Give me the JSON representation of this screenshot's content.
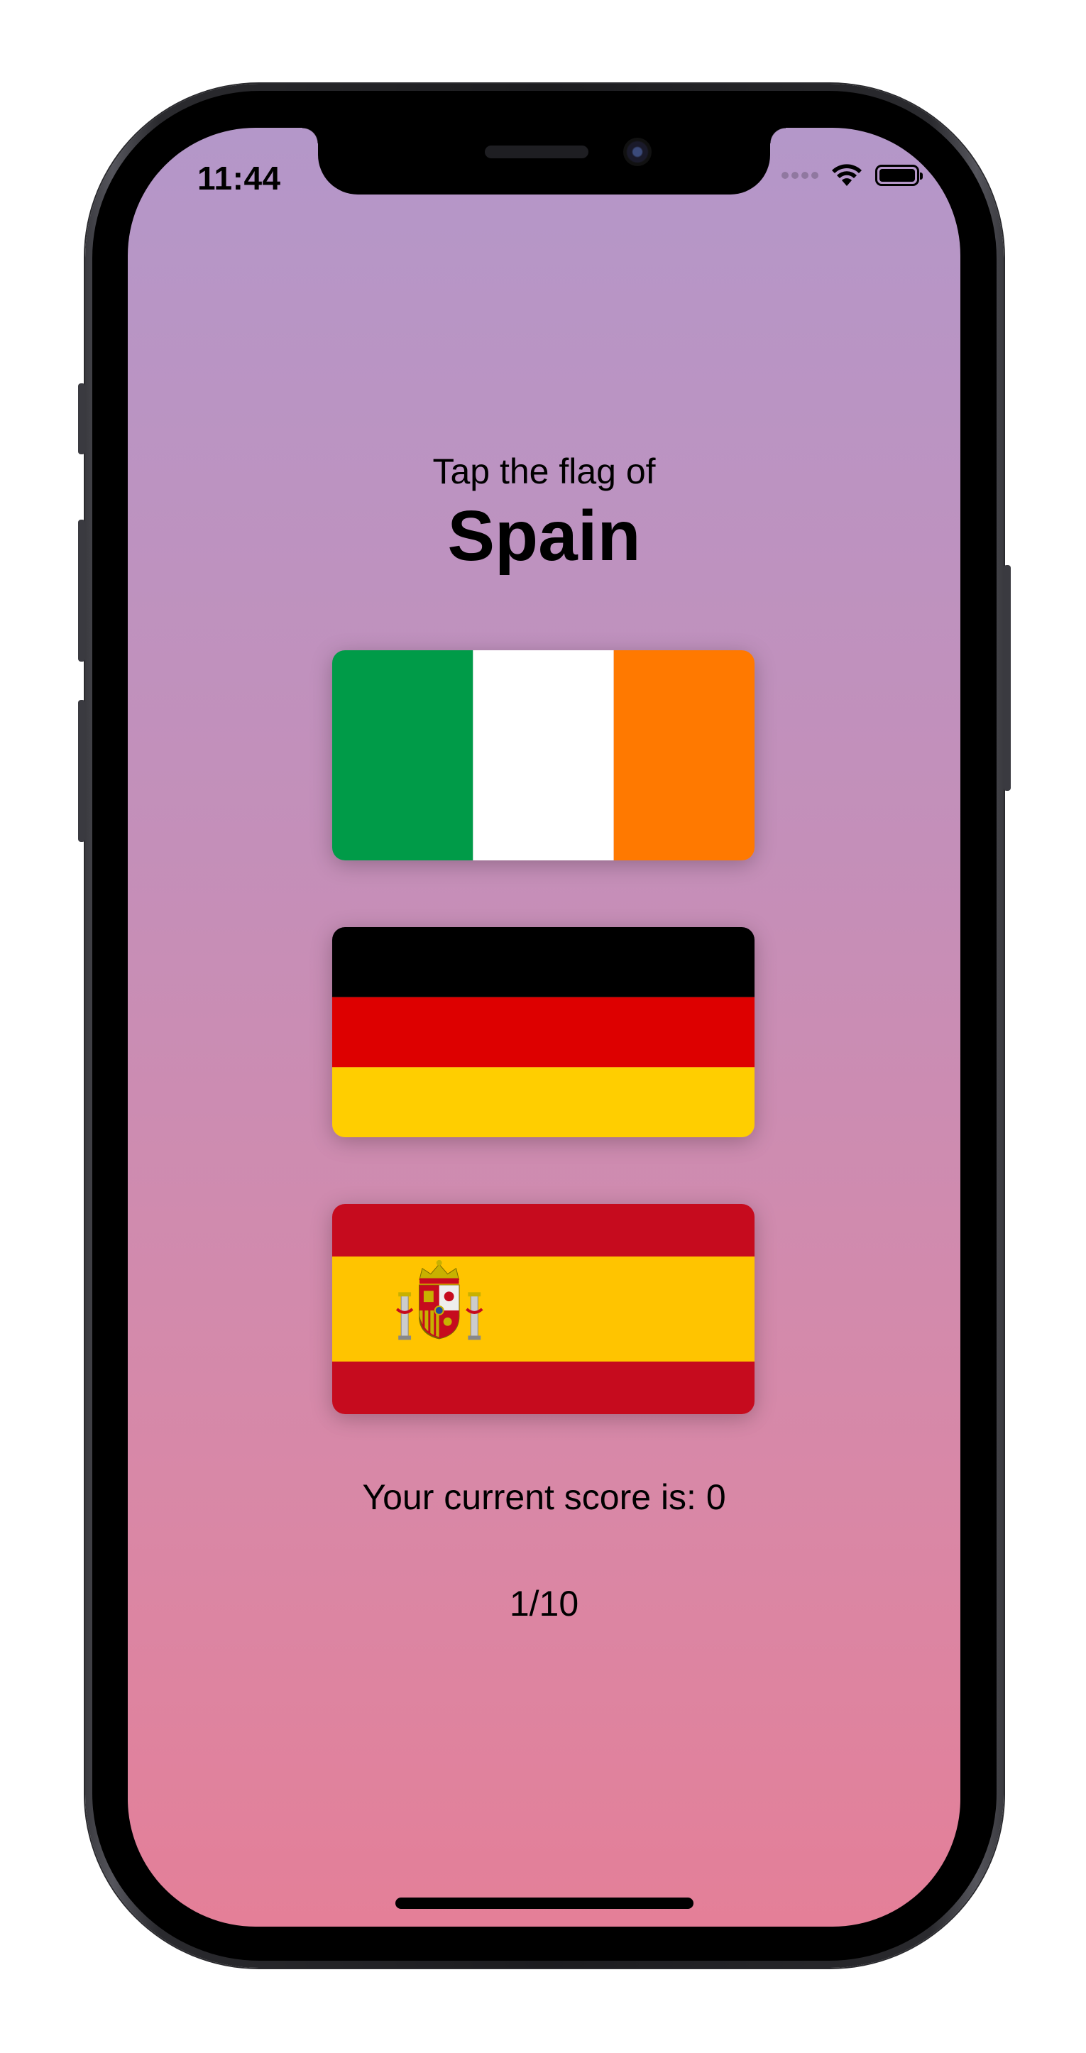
{
  "status_bar": {
    "time": "11:44"
  },
  "game": {
    "prompt": "Tap the flag of",
    "country": "Spain",
    "flags": [
      {
        "country": "Ireland",
        "colors": [
          "#009b48",
          "#ffffff",
          "#ff7900"
        ],
        "layout": "vertical-tricolor"
      },
      {
        "country": "Germany",
        "colors": [
          "#000000",
          "#dd0000",
          "#ffce00"
        ],
        "layout": "horizontal-tricolor"
      },
      {
        "country": "Spain",
        "colors": [
          "#c60b1e",
          "#ffc400",
          "#c60b1e"
        ],
        "layout": "horizontal-1-2-1"
      }
    ],
    "score_text": "Your current score is: 0",
    "progress_text": "1/10"
  },
  "theme": {
    "gradient_top": "#b497c9",
    "gradient_bottom": "#e47f98"
  }
}
